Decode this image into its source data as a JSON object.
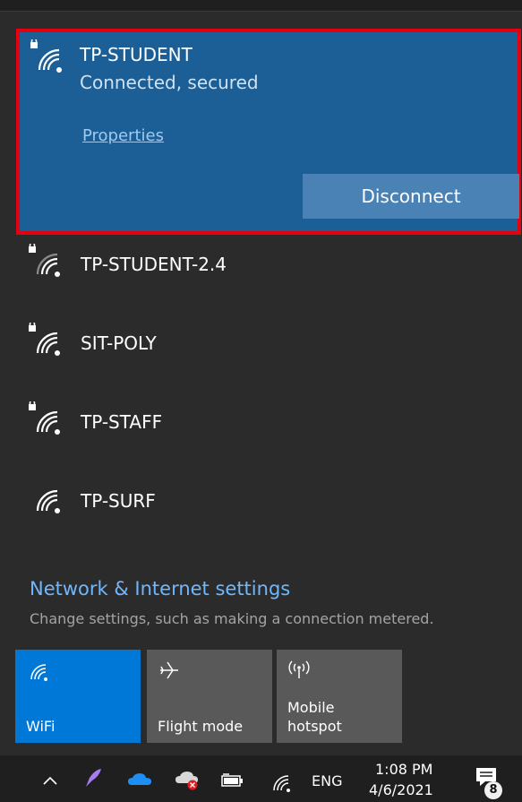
{
  "selected_network": {
    "name": "TP-STUDENT",
    "status": "Connected, secured",
    "properties_label": "Properties",
    "disconnect_label": "Disconnect",
    "secured": true
  },
  "networks": [
    {
      "name": "TP-STUDENT-2.4",
      "secured": true,
      "icon": "wifi-secured-icon"
    },
    {
      "name": "SIT-POLY",
      "secured": true,
      "icon": "wifi-secured-icon"
    },
    {
      "name": "TP-STAFF",
      "secured": true,
      "icon": "wifi-secured-icon"
    },
    {
      "name": "TP-SURF",
      "secured": false,
      "icon": "wifi-icon"
    }
  ],
  "settings": {
    "title": "Network & Internet settings",
    "subtitle": "Change settings, such as making a connection metered."
  },
  "quick_actions": [
    {
      "label": "WiFi",
      "icon": "wifi-icon",
      "active": true
    },
    {
      "label": "Flight mode",
      "icon": "airplane-icon",
      "active": false
    },
    {
      "label": "Mobile\nhotspot",
      "label_line1": "Mobile",
      "label_line2": "hotspot",
      "icon": "hotspot-icon",
      "active": false
    }
  ],
  "taskbar": {
    "language": "ENG",
    "time": "1:08 PM",
    "date": "4/6/2021",
    "notification_count": "8",
    "icons": [
      "chevron-up-icon",
      "pen-icon",
      "onedrive-icon",
      "cloud-error-icon",
      "battery-icon",
      "wifi-icon",
      "notification-icon"
    ]
  },
  "colors": {
    "panel_bg": "#2b2b2b",
    "selected_bg": "#1c5f96",
    "highlight_border": "#e3000f",
    "accent": "#0078d7",
    "link": "#6fb7ff"
  }
}
